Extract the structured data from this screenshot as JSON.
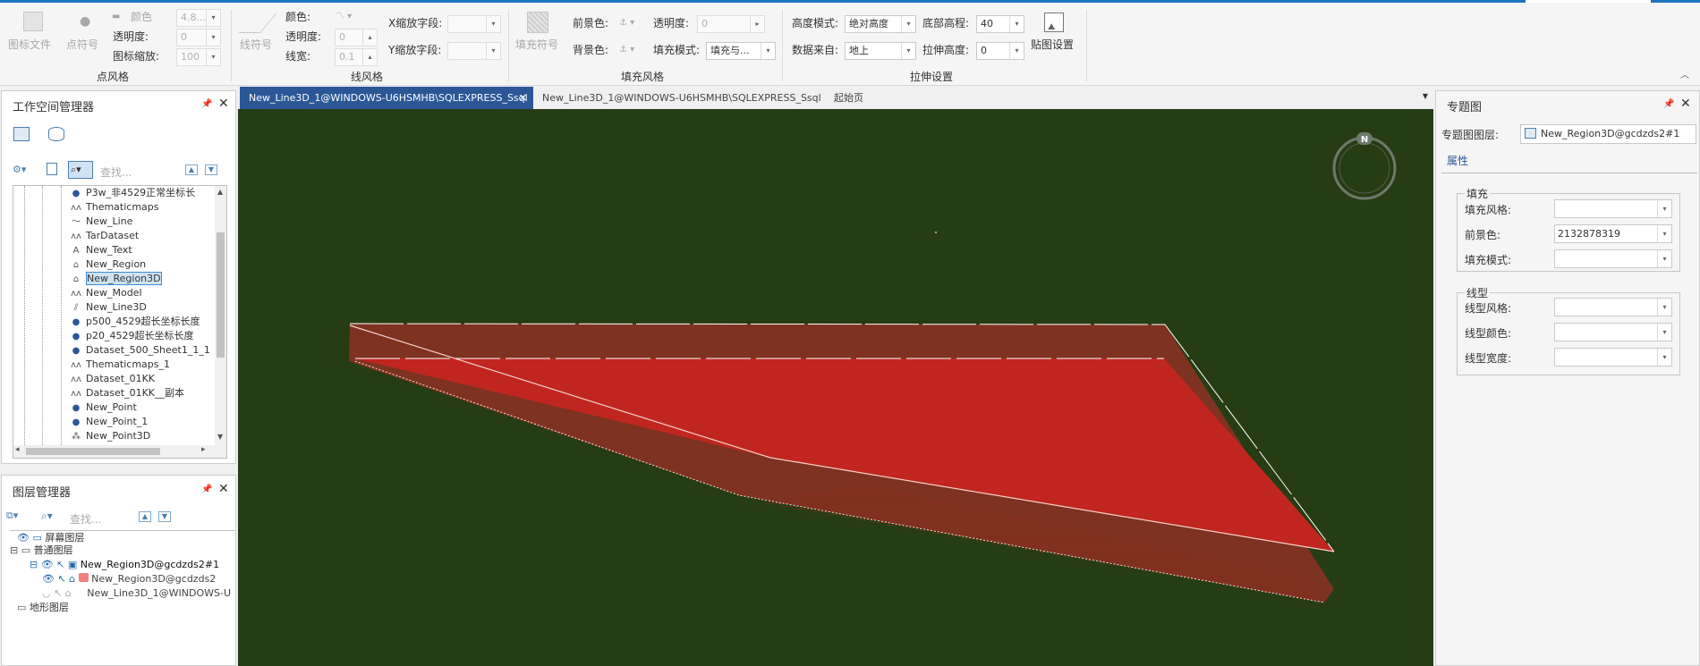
{
  "ribbon": {
    "point_style": {
      "symbol_file": "图标文件",
      "point_symbol": "点符号",
      "color_label": "颜色",
      "size_value": "4.8...",
      "transparency_label": "透明度:",
      "transparency_value": "0",
      "icon_scale_label": "图标缩放:",
      "icon_scale_value": "100",
      "group": "点风格"
    },
    "line_style": {
      "line_symbol": "线符号",
      "color_label": "颜色:",
      "transparency_label": "透明度:",
      "transparency_value": "0",
      "width_label": "线宽:",
      "width_value": "0.1",
      "x_scale_label": "X缩放字段:",
      "y_scale_label": "Y缩放字段:",
      "group": "线风格"
    },
    "fill_style": {
      "fill_symbol": "填充符号",
      "fg_label": "前景色:",
      "bg_label": "背景色:",
      "transparency_label": "透明度:",
      "transparency_value": "0",
      "fill_mode_label": "填充模式:",
      "fill_mode_value": "填充与...",
      "group": "填充风格"
    },
    "extrude": {
      "height_mode_label": "高度模式:",
      "height_mode_value": "绝对高度",
      "data_source_label": "数据来自:",
      "data_source_value": "地上",
      "base_height_label": "底部高程:",
      "base_height_value": "40",
      "extrude_height_label": "拉伸高度:",
      "extrude_height_value": "0",
      "texture_settings": "贴图设置",
      "group": "拉伸设置"
    }
  },
  "workspace": {
    "title": "工作空间管理器",
    "search_placeholder": "查找...",
    "items": [
      {
        "name": "P3w_非4529正常坐标长",
        "icon": "point-icon"
      },
      {
        "name": "Thematicmaps",
        "icon": "thematic-icon"
      },
      {
        "name": "New_Line",
        "icon": "line-icon"
      },
      {
        "name": "TarDataset",
        "icon": "thematic-icon"
      },
      {
        "name": "New_Text",
        "icon": "text-icon"
      },
      {
        "name": "New_Region",
        "icon": "region-icon"
      },
      {
        "name": "New_Region3D",
        "icon": "region3d-icon"
      },
      {
        "name": "New_Model",
        "icon": "thematic-icon"
      },
      {
        "name": "New_Line3D",
        "icon": "line3d-icon"
      },
      {
        "name": "p500_4529超长坐标长度",
        "icon": "point-icon"
      },
      {
        "name": "p20_4529超长坐标长度",
        "icon": "point-icon"
      },
      {
        "name": "Dataset_500_Sheet1_1_1",
        "icon": "point-icon"
      },
      {
        "name": "Thematicmaps_1",
        "icon": "thematic-icon"
      },
      {
        "name": "Dataset_01KK",
        "icon": "thematic-icon"
      },
      {
        "name": "Dataset_01KK__副本",
        "icon": "thematic-icon"
      },
      {
        "name": "New_Point",
        "icon": "point-icon"
      },
      {
        "name": "New_Point_1",
        "icon": "point-icon"
      },
      {
        "name": "New_Point3D",
        "icon": "point3d-icon"
      }
    ]
  },
  "layers": {
    "title": "图层管理器",
    "search_placeholder": "查找...",
    "screen_layers": "屏幕图层",
    "normal_layers": "普通图层",
    "theme_layer": "New_Region3D@gcdzds2#1",
    "region_layer": "New_Region3D@gcdzds2",
    "line_layer": "New_Line3D_1@WINDOWS-U",
    "terrain_layers": "地形图层"
  },
  "tabs": [
    {
      "label": "New_Line3D_1@WINDOWS-U6HSMHB\\SQLEXPRESS_Ssql",
      "active": true
    },
    {
      "label": "New_Line3D_1@WINDOWS-U6HSMHB\\SQLEXPRESS_Ssql",
      "active": false
    },
    {
      "label": "起始页",
      "active": false
    }
  ],
  "scene": {
    "compass_label": "N",
    "colors": {
      "background": "#263c14",
      "region": "#c0261f"
    }
  },
  "thematic": {
    "title": "专题图",
    "layer_label": "专题图图层:",
    "layer_value": "New_Region3D@gcdzds2#1",
    "properties_tab": "属性",
    "fill_group": "填充",
    "fill_style_label": "填充风格:",
    "fg_color_label": "前景色:",
    "fg_color_value": "2132878319",
    "fill_mode_label": "填充模式:",
    "line_group": "线型",
    "line_style_label": "线型风格:",
    "line_color_label": "线型颜色:",
    "line_width_label": "线型宽度:"
  }
}
